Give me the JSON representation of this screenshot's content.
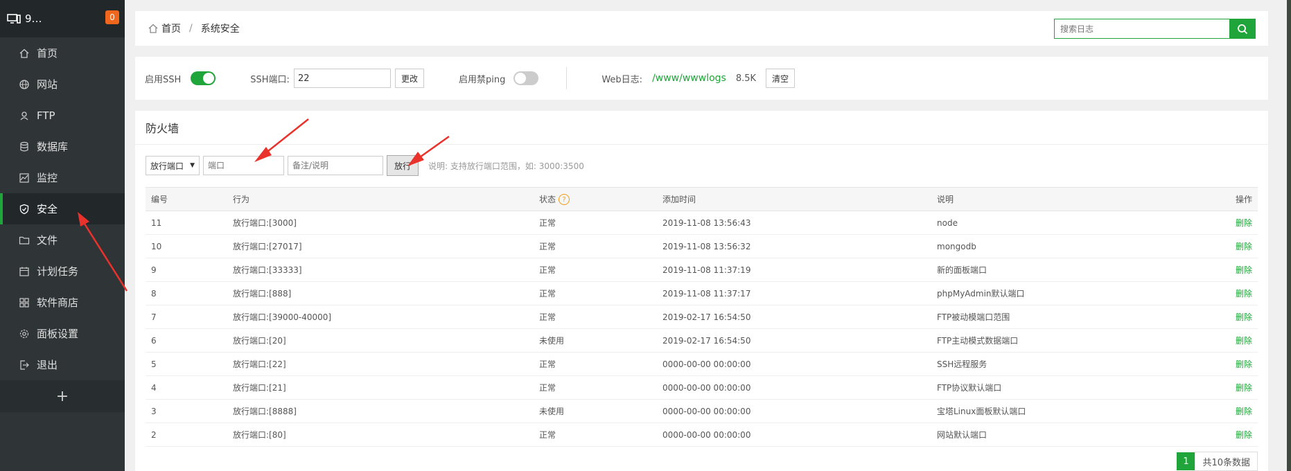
{
  "app": {
    "server_name": "9…",
    "notification_count": "0"
  },
  "sidebar": {
    "items": [
      {
        "label": "首页",
        "icon": "home-icon"
      },
      {
        "label": "网站",
        "icon": "globe-icon"
      },
      {
        "label": "FTP",
        "icon": "ftp-icon"
      },
      {
        "label": "数据库",
        "icon": "database-icon"
      },
      {
        "label": "监控",
        "icon": "monitor-icon"
      },
      {
        "label": "安全",
        "icon": "shield-icon",
        "active": true
      },
      {
        "label": "文件",
        "icon": "folder-icon"
      },
      {
        "label": "计划任务",
        "icon": "calendar-icon"
      },
      {
        "label": "软件商店",
        "icon": "apps-icon"
      },
      {
        "label": "面板设置",
        "icon": "gear-icon"
      },
      {
        "label": "退出",
        "icon": "logout-icon"
      }
    ],
    "add_label": "+"
  },
  "header": {
    "breadcrumb_home": "首页",
    "breadcrumb_sep": "/",
    "breadcrumb_current": "系统安全",
    "search_placeholder": "搜索日志"
  },
  "settings": {
    "ssh_label": "启用SSH",
    "ssh_enabled": true,
    "ssh_port_label": "SSH端口:",
    "ssh_port_value": "22",
    "change_button": "更改",
    "ping_label": "启用禁ping",
    "ping_enabled": false,
    "weblog_label": "Web日志:",
    "weblog_path": "/www/wwwlogs",
    "weblog_size": "8.5K",
    "clear_button": "清空"
  },
  "firewall": {
    "title": "防火墙",
    "type_select": "放行端口",
    "port_placeholder": "端口",
    "note_placeholder": "备注/说明",
    "allow_button": "放行",
    "hint": "说明: 支持放行端口范围，如: 3000:3500",
    "columns": [
      "编号",
      "行为",
      "状态",
      "添加时间",
      "说明",
      "操作"
    ],
    "status_help": "?",
    "rows": [
      {
        "id": "11",
        "action": "放行端口:[3000]",
        "status": "正常",
        "time": "2019-11-08 13:56:43",
        "note": "node",
        "op": "删除"
      },
      {
        "id": "10",
        "action": "放行端口:[27017]",
        "status": "正常",
        "time": "2019-11-08 13:56:32",
        "note": "mongodb",
        "op": "删除"
      },
      {
        "id": "9",
        "action": "放行端口:[33333]",
        "status": "正常",
        "time": "2019-11-08 11:37:19",
        "note": "新的面板端口",
        "op": "删除"
      },
      {
        "id": "8",
        "action": "放行端口:[888]",
        "status": "正常",
        "time": "2019-11-08 11:37:17",
        "note": "phpMyAdmin默认端口",
        "op": "删除"
      },
      {
        "id": "7",
        "action": "放行端口:[39000-40000]",
        "status": "正常",
        "time": "2019-02-17 16:54:50",
        "note": "FTP被动模端口范围",
        "op": "删除"
      },
      {
        "id": "6",
        "action": "放行端口:[20]",
        "status": "未使用",
        "time": "2019-02-17 16:54:50",
        "note": "FTP主动模式数据端口",
        "op": "删除"
      },
      {
        "id": "5",
        "action": "放行端口:[22]",
        "status": "正常",
        "time": "0000-00-00 00:00:00",
        "note": "SSH远程服务",
        "op": "删除"
      },
      {
        "id": "4",
        "action": "放行端口:[21]",
        "status": "正常",
        "time": "0000-00-00 00:00:00",
        "note": "FTP协议默认端口",
        "op": "删除"
      },
      {
        "id": "3",
        "action": "放行端口:[8888]",
        "status": "未使用",
        "time": "0000-00-00 00:00:00",
        "note": "宝塔Linux面板默认端口",
        "op": "删除"
      },
      {
        "id": "2",
        "action": "放行端口:[80]",
        "status": "正常",
        "time": "0000-00-00 00:00:00",
        "note": "网站默认端口",
        "op": "删除"
      }
    ],
    "pager_current": "1",
    "pager_total": "共10条数据"
  },
  "colors": {
    "accent": "#20a53a",
    "sidebar_bg": "#2f3437",
    "annotation": "#e8322b"
  }
}
